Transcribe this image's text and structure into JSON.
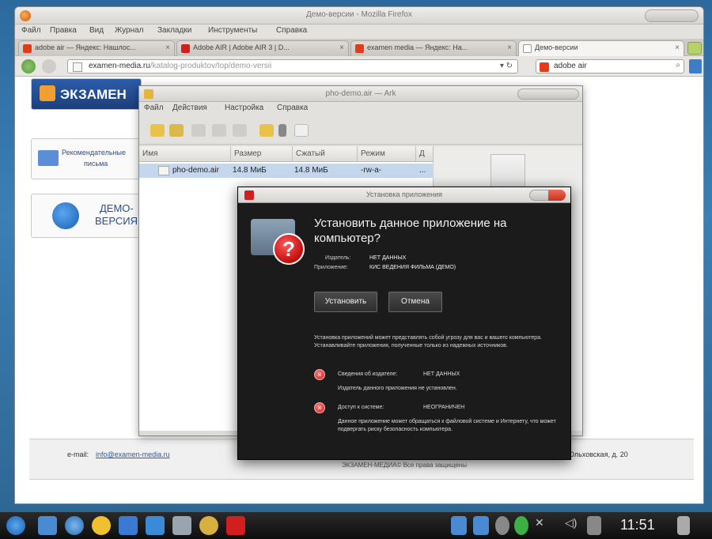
{
  "firefox": {
    "title": "Демо-версии - Mozilla Firefox",
    "menu": [
      "Файл",
      "Правка",
      "Вид",
      "Журнал",
      "Закладки",
      "Инструменты",
      "Справка"
    ],
    "tabs": [
      {
        "label": "adobe air — Яндекс: Нашлос...",
        "icon_color": "#e23b1a"
      },
      {
        "label": "Adobe AIR | Adobe AIR 3 | D...",
        "icon_color": "#d41e1e"
      },
      {
        "label": "examen media — Яндекс: На...",
        "icon_color": "#e23b1a"
      },
      {
        "label": "Демо-версии",
        "icon_color": "#ffffff"
      }
    ],
    "url_domain": "examen-media.ru",
    "url_path": "/katalog-produktov/top/demo-versii",
    "search_value": "adobe air"
  },
  "site": {
    "logo_text": "ЭКЗАМЕН",
    "rec_letters_line1": "Рекомендательные",
    "rec_letters_line2": "письма",
    "demo_line1": "ДЕМО-",
    "demo_line2": "ВЕРСИЯ",
    "email_label": "e-mail:",
    "email_value": "info@examen-media.ru",
    "copyright": "ЭКЗАМЕН-МЕДИА© Все права защищены",
    "address": "Ольховская, д. 20"
  },
  "archive": {
    "title": "pho-demo.air — Ark",
    "menu": [
      "Файл",
      "Действия",
      "Настройка",
      "Справка"
    ],
    "columns": [
      "Имя",
      "Размер",
      "Сжатый",
      "Режим",
      "Д"
    ],
    "file": {
      "name": "pho-demo.air",
      "size": "14.8 МиБ",
      "compressed": "14.8 МиБ",
      "mode": "-rw-a-",
      "date": "..."
    }
  },
  "install_dialog": {
    "title": "Установка приложения",
    "heading": "Установить данное приложение на компьютер?",
    "publisher_label": "Издатель:",
    "publisher_value": "НЕТ ДАННЫХ",
    "app_label": "Приложение:",
    "app_value": "КИС ВЕДЕНИЯ ФИЛЬМА (ДЕМО)",
    "install_label": "Установить",
    "cancel_label": "Отмена",
    "warning": "Установка приложений может представлять собой угрозу для вас и вашего компьютера. Устанавливайте приложения, полученные только из надежных источников.",
    "risk1_title": "Сведения об издателе:",
    "risk1_value": "НЕТ ДАННЫХ",
    "risk1_desc": "Издатель данного приложения не установлен.",
    "risk2_title": "Доступ к системе:",
    "risk2_value": "НЕОГРАНИЧЕН",
    "risk2_desc": "Данное приложение может обращаться к файловой системе и Интернету, что может подвергать риску безопасность компьютера."
  },
  "taskbar": {
    "clock": "11:51",
    "icons": [
      "kde-menu-icon",
      "desktop-icon",
      "konqueror-icon",
      "chat-icon",
      "mail-icon",
      "media-icon",
      "files-icon",
      "archive-icon",
      "adobe-air-icon"
    ]
  }
}
